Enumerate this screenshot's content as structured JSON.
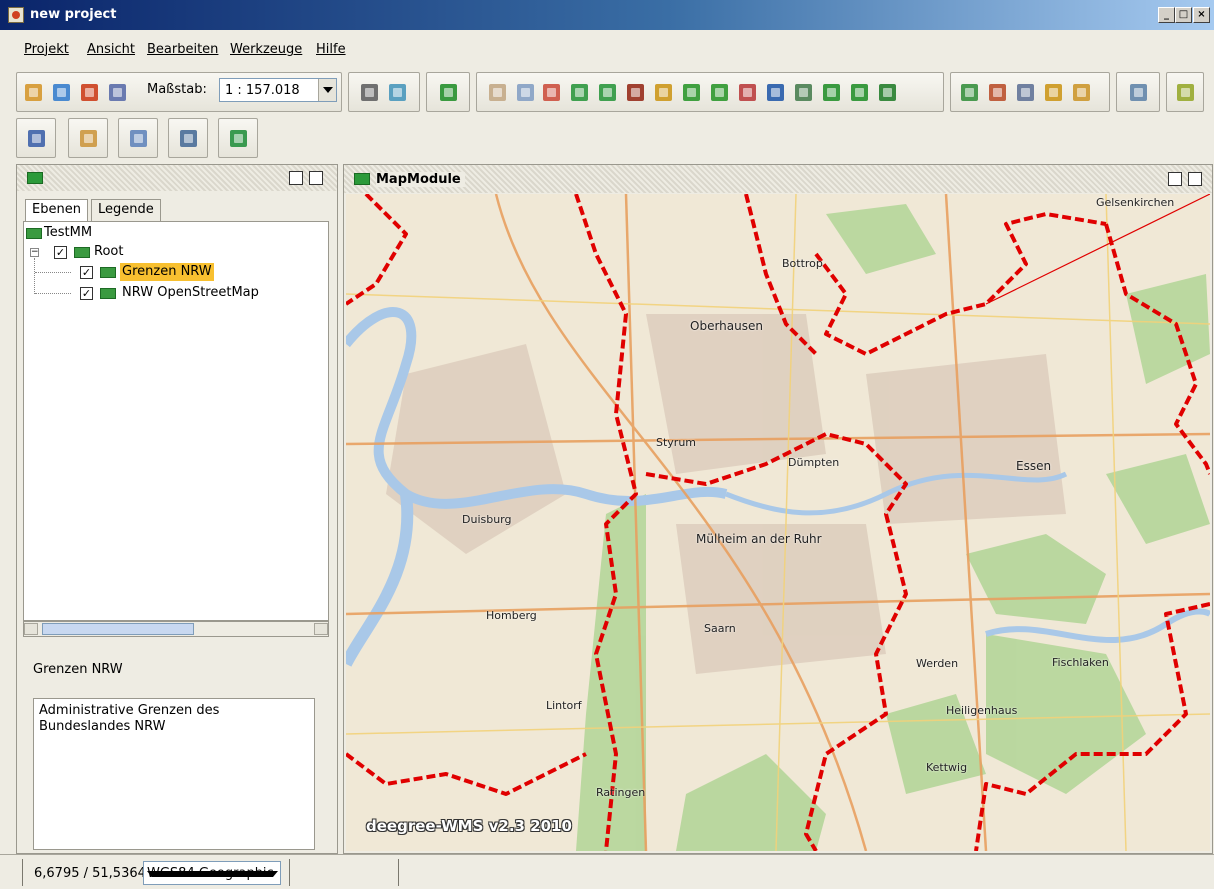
{
  "window": {
    "title": "new project"
  },
  "menu": [
    "Projekt",
    "Ansicht",
    "Bearbeiten",
    "Werkzeuge",
    "Hilfe"
  ],
  "toolbar": {
    "scale_label": "Maßstab:",
    "scale_value": "1 : 157.018"
  },
  "left_panel": {
    "tabs": [
      "Ebenen",
      "Legende"
    ],
    "tree": {
      "root_label": "TestMM",
      "group_label": "Root",
      "layers": [
        {
          "label": "Grenzen NRW",
          "checked": true,
          "selected": true
        },
        {
          "label": "NRW OpenStreetMap",
          "checked": true,
          "selected": false
        }
      ]
    },
    "info_title": "Grenzen NRW",
    "info_text": "Administrative Grenzen des Bundeslandes NRW"
  },
  "map_panel": {
    "title": "MapModule",
    "watermark": "deegree-WMS v2.3 2010",
    "places": [
      "Oberhausen",
      "Bottrop",
      "Essen",
      "Mülheim an der Ruhr",
      "Duisburg",
      "Gelsenkirchen",
      "Styrum",
      "Dümpten",
      "Kettwig",
      "Heiligenhaus",
      "Ratingen",
      "Fischlaken",
      "Werden",
      "Homberg",
      "Lintorf",
      "Saarn"
    ]
  },
  "status": {
    "coords": "6,6795 / 51,5364",
    "crs": "WGS84 Geographic"
  },
  "colors": {
    "boundary": "#e00000",
    "forest": "#b5d69a",
    "river": "#a9c8e8",
    "landuse": "#f0e6d0"
  }
}
